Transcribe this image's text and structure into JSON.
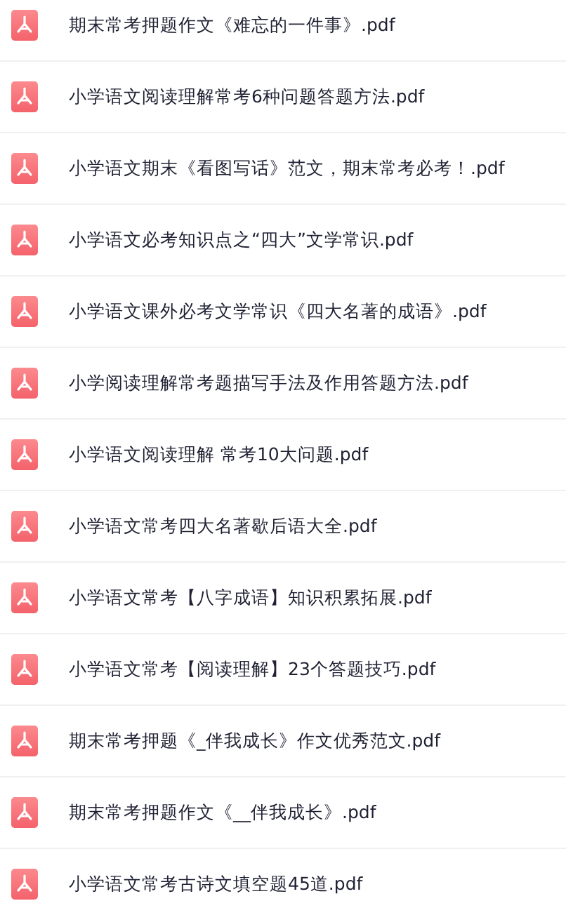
{
  "files": [
    {
      "name": "期末常考押题作文《难忘的一件事》.pdf"
    },
    {
      "name": "小学语文阅读理解常考6种问题答题方法.pdf"
    },
    {
      "name": "小学语文期末《看图写话》范文，期末常考必考！.pdf"
    },
    {
      "name": "小学语文必考知识点之“四大”文学常识.pdf"
    },
    {
      "name": "小学语文课外必考文学常识《四大名著的成语》.pdf"
    },
    {
      "name": "小学阅读理解常考题描写手法及作用答题方法.pdf"
    },
    {
      "name": "小学语文阅读理解 常考10大问题.pdf"
    },
    {
      "name": "小学语文常考四大名著歇后语大全.pdf"
    },
    {
      "name": "小学语文常考【八字成语】知识积累拓展.pdf"
    },
    {
      "name": "小学语文常考【阅读理解】23个答题技巧.pdf"
    },
    {
      "name": "期末常考押题《_伴我成长》作文优秀范文.pdf"
    },
    {
      "name": "期末常考押题作文《__伴我成长》.pdf"
    },
    {
      "name": "小学语文常考古诗文填空题45道.pdf"
    }
  ]
}
